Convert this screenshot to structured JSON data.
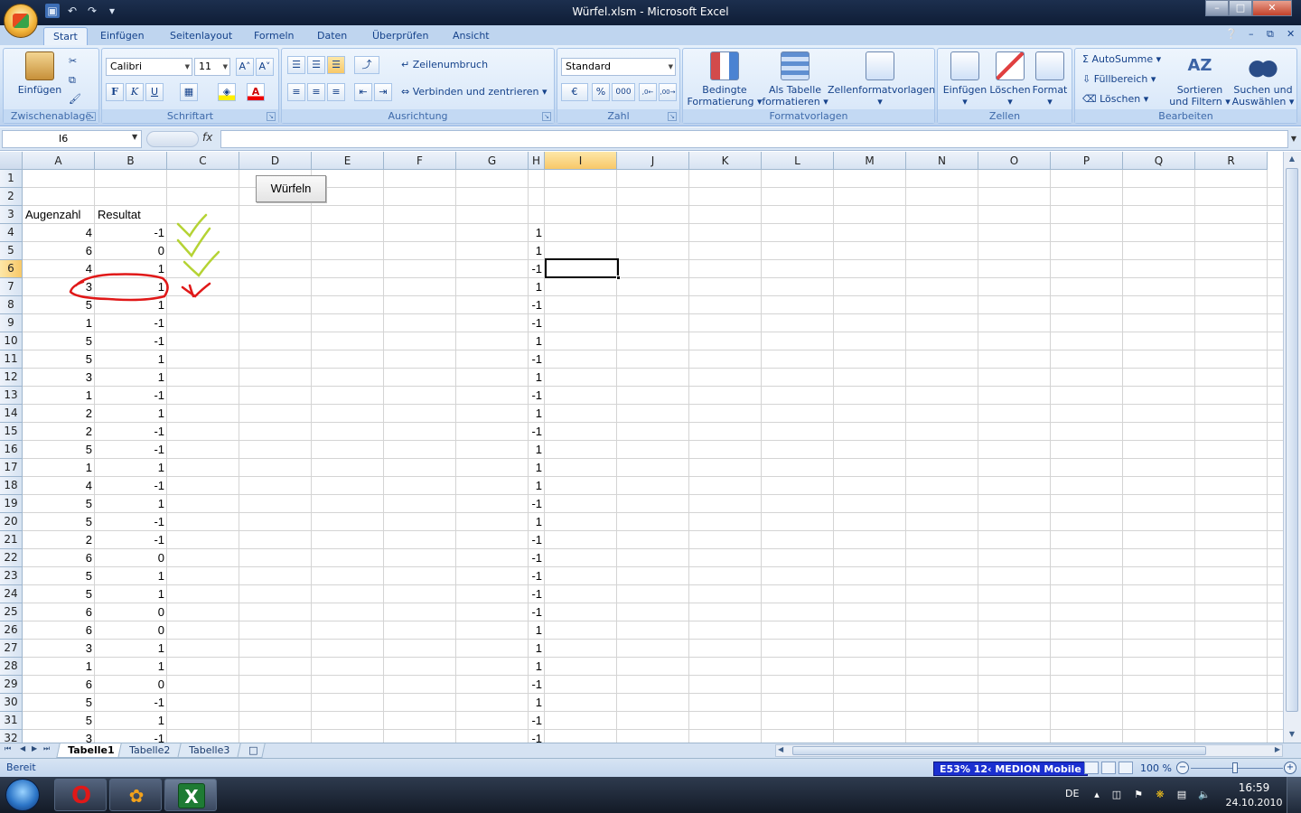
{
  "window": {
    "title": "Würfel.xlsm - Microsoft Excel",
    "minimize": "–",
    "restore": "□",
    "close": "✕"
  },
  "ribbon_tabs": [
    "Start",
    "Einfügen",
    "Seitenlayout",
    "Formeln",
    "Daten",
    "Überprüfen",
    "Ansicht"
  ],
  "ribbon": {
    "clipboard": {
      "paste": "Einfügen",
      "label": "Zwischenablage"
    },
    "font": {
      "name": "Calibri",
      "size": "11",
      "bold": "F",
      "italic": "K",
      "underline": "U",
      "grow": "A˄",
      "shrink": "A˅",
      "color_a": "A",
      "label": "Schriftart"
    },
    "alignment": {
      "wrap": "Zeilenumbruch",
      "merge": "Verbinden und zentrieren",
      "label": "Ausrichtung"
    },
    "number": {
      "format": "Standard",
      "percent": "%",
      "thousands": "000",
      "inc": ",0←",
      "dec": ",00→",
      "label": "Zahl"
    },
    "styles": {
      "conditional_1": "Bedingte",
      "conditional_2": "Formatierung",
      "table_1": "Als Tabelle",
      "table_2": "formatieren",
      "cellstyles": "Zellenformatvorlagen",
      "label": "Formatvorlagen"
    },
    "cells": {
      "insert": "Einfügen",
      "delete": "Löschen",
      "format": "Format",
      "label": "Zellen"
    },
    "editing": {
      "autosum": "AutoSumme",
      "fill": "Füllbereich",
      "clear": "Löschen",
      "sort_1": "Sortieren",
      "sort_2": "und Filtern",
      "find_1": "Suchen und",
      "find_2": "Auswählen",
      "label": "Bearbeiten"
    }
  },
  "formula_bar": {
    "name_box": "I6",
    "fx": "fx",
    "formula": ""
  },
  "columns": [
    "A",
    "B",
    "C",
    "D",
    "E",
    "F",
    "G",
    "H",
    "I",
    "J",
    "K",
    "L",
    "M",
    "N",
    "O",
    "P",
    "Q",
    "R"
  ],
  "rows": [
    "1",
    "2",
    "3",
    "4",
    "5",
    "6",
    "7",
    "8",
    "9",
    "10",
    "11",
    "12",
    "13",
    "14",
    "15",
    "16",
    "17",
    "18",
    "19",
    "20",
    "21",
    "22",
    "23",
    "24",
    "25",
    "26",
    "27",
    "28",
    "29",
    "30",
    "31",
    "32"
  ],
  "headers": {
    "a3": "Augenzahl",
    "b3": "Resultat"
  },
  "button_label": "Würfeln",
  "col_a": [
    "4",
    "6",
    "4",
    "3",
    "5",
    "1",
    "5",
    "5",
    "3",
    "1",
    "2",
    "2",
    "5",
    "1",
    "4",
    "5",
    "5",
    "2",
    "6",
    "5",
    "5",
    "6",
    "6",
    "3",
    "1",
    "6",
    "5",
    "5",
    "3"
  ],
  "col_b": [
    "-1",
    "0",
    "1",
    "1",
    "1",
    "-1",
    "-1",
    "1",
    "1",
    "-1",
    "1",
    "-1",
    "-1",
    "1",
    "-1",
    "1",
    "-1",
    "-1",
    "0",
    "1",
    "1",
    "0",
    "0",
    "1",
    "1",
    "0",
    "-1",
    "1",
    "-1"
  ],
  "col_h": [
    "1",
    "1",
    "-1",
    "1",
    "-1",
    "-1",
    "1",
    "-1",
    "1",
    "-1",
    "1",
    "-1",
    "1",
    "1",
    "1",
    "-1",
    "1",
    "-1",
    "-1",
    "-1",
    "-1",
    "-1",
    "1",
    "1",
    "1",
    "-1",
    "1",
    "-1",
    "-1"
  ],
  "selected_cell": {
    "column": "I",
    "row": "6"
  },
  "sheet_tabs": [
    "Tabelle1",
    "Tabelle2",
    "Tabelle3"
  ],
  "active_sheet": "Tabelle1",
  "status": {
    "ready": "Bereit",
    "battery": "E53% 12‹ MEDION Mobile",
    "zoom": "100 %",
    "zoom_out": "−",
    "zoom_in": "+"
  },
  "taskbar": {
    "lang": "DE",
    "time": "16:59",
    "date": "24.10.2010"
  },
  "colors": {
    "accent": "#15428b",
    "selection_header": "#f8c868",
    "check_green": "#b5d334",
    "cross_red": "#e01818"
  }
}
